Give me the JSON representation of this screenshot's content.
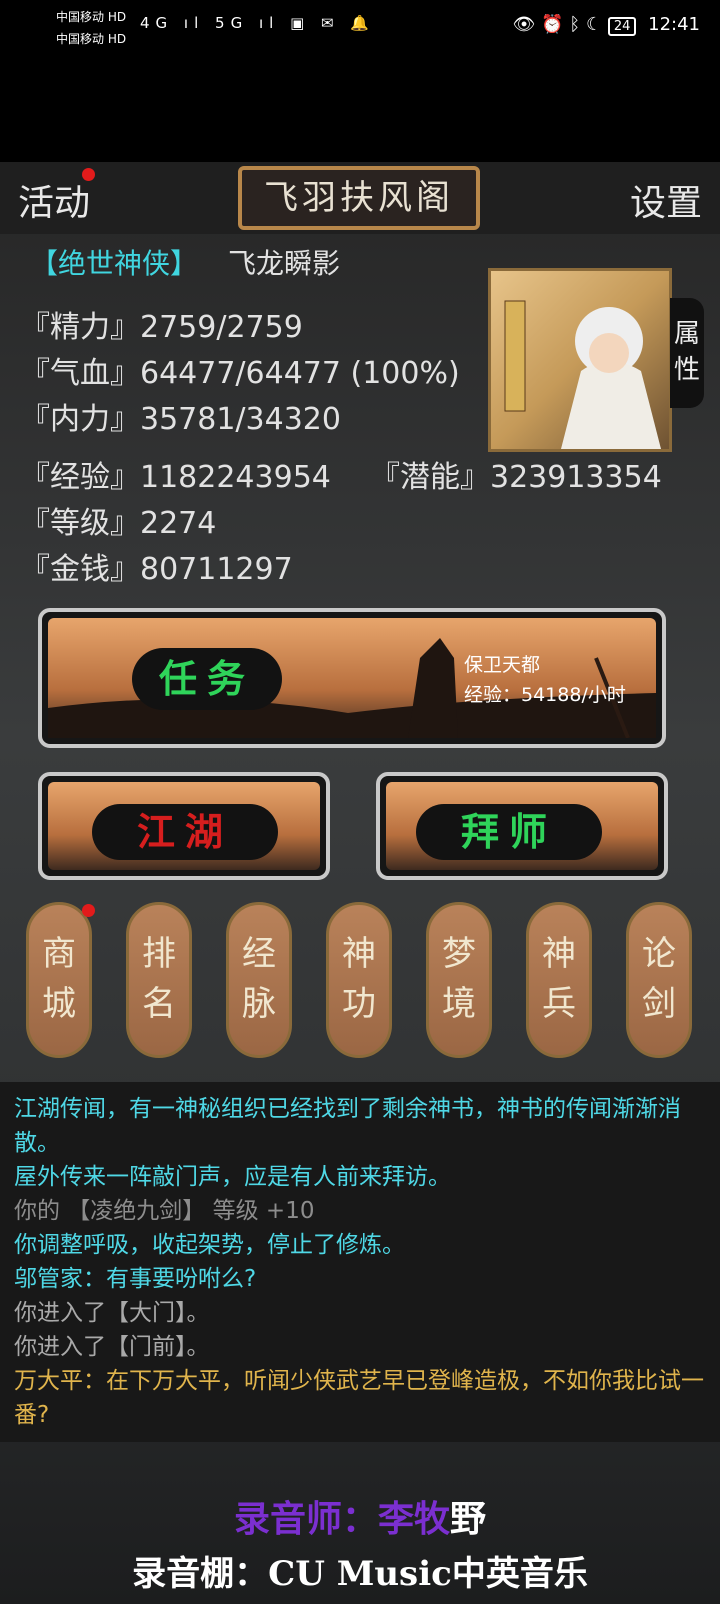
{
  "status_bar": {
    "carrier1": "中国移动 HD",
    "carrier2": "中国移动 HD",
    "signal_icons": "4G ıl 5G ıl ▣ ✉ 🔔",
    "battery": "24",
    "time": "12:41"
  },
  "header": {
    "activity_label": "活动",
    "title": "飞羽扶风阁",
    "settings_label": "设置"
  },
  "character": {
    "rank": "【绝世神侠】",
    "name": "飞龙瞬影",
    "stats": [
      {
        "label": "『精力』",
        "value": "2759/2759"
      },
      {
        "label": "『气血』",
        "value": "64477/64477 (100%)"
      },
      {
        "label": "『内力』",
        "value": "35781/34320"
      },
      {
        "label": "『经验』",
        "value": "1182243954"
      },
      {
        "label": "『潜能』",
        "value": "323913354"
      },
      {
        "label": "『等级』",
        "value": "2274"
      },
      {
        "label": "『金钱』",
        "value": "80711297"
      }
    ],
    "attr_tab": "属性"
  },
  "task": {
    "label": "任务",
    "quest": "保卫天都",
    "exp_rate": "经验：54188/小时"
  },
  "buttons": {
    "jianghu": "江湖",
    "baishi": "拜师"
  },
  "tiles": [
    {
      "top": "商",
      "bottom": "城"
    },
    {
      "top": "排",
      "bottom": "名"
    },
    {
      "top": "经",
      "bottom": "脉"
    },
    {
      "top": "神",
      "bottom": "功"
    },
    {
      "top": "梦",
      "bottom": "境"
    },
    {
      "top": "神",
      "bottom": "兵"
    },
    {
      "top": "论",
      "bottom": "剑"
    }
  ],
  "log": [
    {
      "text": "江湖传闻，有一神秘组织已经找到了剩余神书，神书的传闻渐渐消散。",
      "color": "#4fd8e6"
    },
    {
      "text": "屋外传来一阵敲门声，应是有人前来拜访。",
      "color": "#4fd8e6"
    },
    {
      "text": "你的 【凌绝九剑】 等级 +10",
      "color": "#8d8d8d"
    },
    {
      "text": "你调整呼吸，收起架势，停止了修炼。",
      "color": "#4fd8e6"
    },
    {
      "text": "邬管家：有事要吩咐么?",
      "color": "#4fd8e6"
    },
    {
      "text": "你进入了【大门】。",
      "color": "#a9a9a9"
    },
    {
      "text": "你进入了【门前】。",
      "color": "#a9a9a9"
    },
    {
      "text": "万大平：在下万大平，听闻少侠武艺早已登峰造极，不如你我比试一番?",
      "color": "#e0b44c"
    }
  ],
  "credits": {
    "line1_prefix": "录音师：",
    "line1_name": "李牧",
    "line1_suffix": "野",
    "line2": "录音棚：CU Music中英音乐"
  },
  "colors": {
    "cyan": "#40d6e0",
    "gold": "#e0b44c",
    "red_text": "#d61e1e",
    "green_text": "#2fd45a",
    "purple": "#7b2fd0"
  }
}
